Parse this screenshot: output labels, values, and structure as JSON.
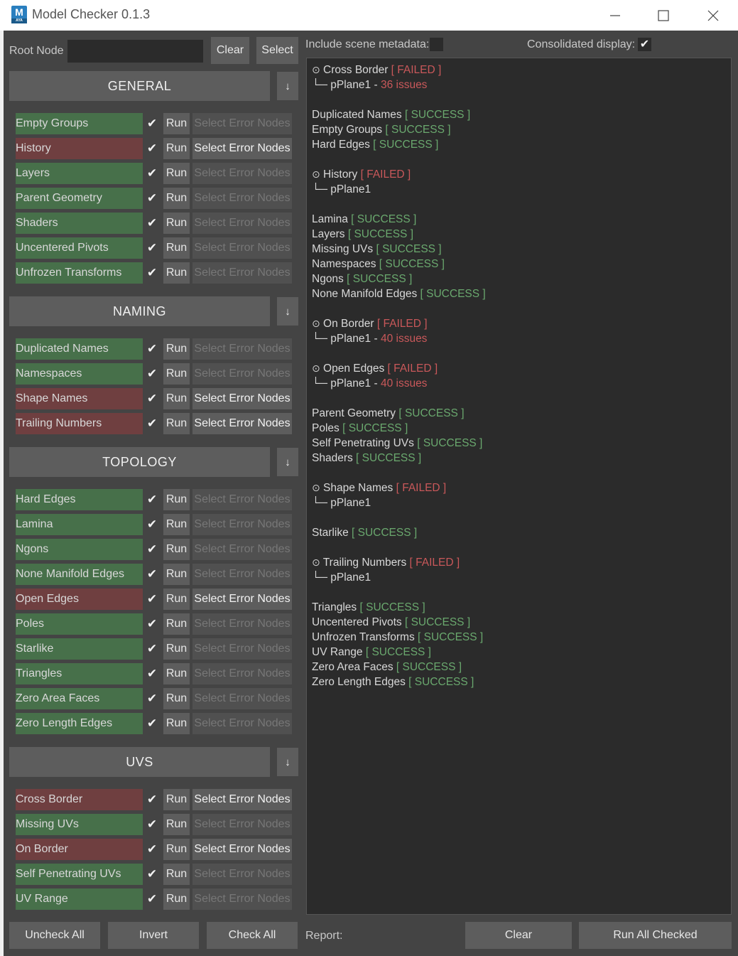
{
  "window": {
    "title": "Model Checker 0.1.3",
    "icon_letter": "M",
    "icon_sub": "AYA"
  },
  "top": {
    "root_label": "Root Node",
    "root_value": "",
    "clear_label": "Clear",
    "select_label": "Select",
    "include_meta_label": "Include scene metadata:",
    "include_meta_checked": false,
    "consolidated_label": "Consolidated display:",
    "consolidated_checked": true,
    "check_glyph": "✔"
  },
  "strings": {
    "run": "Run",
    "select_error": "Select Error Nodes",
    "arrow": "↓"
  },
  "sections": [
    {
      "name": "GENERAL",
      "items": [
        {
          "label": "Empty Groups",
          "status": "ok"
        },
        {
          "label": "History",
          "status": "fail"
        },
        {
          "label": "Layers",
          "status": "ok"
        },
        {
          "label": "Parent Geometry",
          "status": "ok"
        },
        {
          "label": "Shaders",
          "status": "ok"
        },
        {
          "label": "Uncentered Pivots",
          "status": "ok"
        },
        {
          "label": "Unfrozen Transforms",
          "status": "ok"
        }
      ]
    },
    {
      "name": "NAMING",
      "items": [
        {
          "label": "Duplicated Names",
          "status": "ok"
        },
        {
          "label": "Namespaces",
          "status": "ok"
        },
        {
          "label": "Shape Names",
          "status": "fail"
        },
        {
          "label": "Trailing Numbers",
          "status": "fail"
        }
      ]
    },
    {
      "name": "TOPOLOGY",
      "items": [
        {
          "label": "Hard Edges",
          "status": "ok"
        },
        {
          "label": "Lamina",
          "status": "ok"
        },
        {
          "label": "Ngons",
          "status": "ok"
        },
        {
          "label": "None Manifold Edges",
          "status": "ok"
        },
        {
          "label": "Open Edges",
          "status": "fail"
        },
        {
          "label": "Poles",
          "status": "ok"
        },
        {
          "label": "Starlike",
          "status": "ok"
        },
        {
          "label": "Triangles",
          "status": "ok"
        },
        {
          "label": "Zero Area Faces",
          "status": "ok"
        },
        {
          "label": "Zero Length Edges",
          "status": "ok"
        }
      ]
    },
    {
      "name": "UVS",
      "items": [
        {
          "label": "Cross Border",
          "status": "fail"
        },
        {
          "label": "Missing UVs",
          "status": "ok"
        },
        {
          "label": "On Border",
          "status": "fail"
        },
        {
          "label": "Self Penetrating UVs",
          "status": "ok"
        },
        {
          "label": "UV Range",
          "status": "ok"
        }
      ]
    }
  ],
  "report": {
    "success_tag": "[ SUCCESS ]",
    "failed_tag": "[ FAILED ]",
    "fail_marker": "⊙",
    "node_prefix": "└─",
    "lines": [
      {
        "type": "fail",
        "name": "Cross Border"
      },
      {
        "type": "node",
        "node": "pPlane1",
        "issues": "36 issues"
      },
      {
        "type": "blank"
      },
      {
        "type": "ok",
        "name": "Duplicated Names"
      },
      {
        "type": "ok",
        "name": "Empty Groups"
      },
      {
        "type": "ok",
        "name": "Hard Edges"
      },
      {
        "type": "blank"
      },
      {
        "type": "fail",
        "name": "History"
      },
      {
        "type": "node",
        "node": "pPlane1"
      },
      {
        "type": "blank"
      },
      {
        "type": "ok",
        "name": "Lamina"
      },
      {
        "type": "ok",
        "name": "Layers"
      },
      {
        "type": "ok",
        "name": "Missing UVs"
      },
      {
        "type": "ok",
        "name": "Namespaces"
      },
      {
        "type": "ok",
        "name": "Ngons"
      },
      {
        "type": "ok",
        "name": "None Manifold Edges"
      },
      {
        "type": "blank"
      },
      {
        "type": "fail",
        "name": "On Border"
      },
      {
        "type": "node",
        "node": "pPlane1",
        "issues": "40 issues"
      },
      {
        "type": "blank"
      },
      {
        "type": "fail",
        "name": "Open Edges"
      },
      {
        "type": "node",
        "node": "pPlane1",
        "issues": "40 issues"
      },
      {
        "type": "blank"
      },
      {
        "type": "ok",
        "name": "Parent Geometry"
      },
      {
        "type": "ok",
        "name": "Poles"
      },
      {
        "type": "ok",
        "name": "Self Penetrating UVs"
      },
      {
        "type": "ok",
        "name": "Shaders"
      },
      {
        "type": "blank"
      },
      {
        "type": "fail",
        "name": "Shape Names"
      },
      {
        "type": "node",
        "node": "pPlane1"
      },
      {
        "type": "blank"
      },
      {
        "type": "ok",
        "name": "Starlike"
      },
      {
        "type": "blank"
      },
      {
        "type": "fail",
        "name": "Trailing Numbers"
      },
      {
        "type": "node",
        "node": "pPlane1"
      },
      {
        "type": "blank"
      },
      {
        "type": "ok",
        "name": "Triangles"
      },
      {
        "type": "ok",
        "name": "Uncentered Pivots"
      },
      {
        "type": "ok",
        "name": "Unfrozen Transforms"
      },
      {
        "type": "ok",
        "name": "UV Range"
      },
      {
        "type": "ok",
        "name": "Zero Area Faces"
      },
      {
        "type": "ok",
        "name": "Zero Length Edges"
      }
    ]
  },
  "bottom": {
    "uncheck_all": "Uncheck All",
    "invert": "Invert",
    "check_all": "Check All",
    "report_label": "Report:",
    "clear": "Clear",
    "run_all": "Run All Checked"
  }
}
